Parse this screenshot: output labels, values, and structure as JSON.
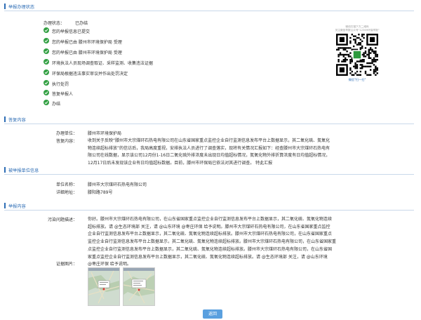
{
  "sections": {
    "status_title": "举报办理状态",
    "reply_title": "答复内容",
    "reported_title": "被举报单位信息",
    "content_title": "举报内容"
  },
  "status": {
    "label": "办理状态：",
    "value": "已办结",
    "steps": [
      "您的举报信息已提交",
      "您的举报已由 滕州市环境保护局 受理",
      "您的举报已由 滕州市环境保护局 受理",
      "环境执法人员现场调查取证、采样监测、收集违法证据",
      "环保局根据违法事实审议并作出处罚决定",
      "执行处罚",
      "答复举报人",
      "办结"
    ]
  },
  "qr": {
    "note_line1": "微信扫描下方二维码",
    "note_line2": "关注微信举报公众号\"12369环保举报\"",
    "scan_label": "微信\"扫一扫\""
  },
  "reply": {
    "unit_label": "办理单位：",
    "unit_value": "滕州市环境保护局",
    "content_label": "答复内容：",
    "content_lines": [
      "收到关于反映“滕州市大宗煤矸石热电有限公司在山东省国家重点监控企业自行监测信息发布平台上数据显示，其二氧化硫、氮氧化",
      "物连续超标排放”的信访后，我局高度重视，安排执法人员进行了调查落实，现将有关情况汇报如下：经查滕州市大宗煤矸石热电有",
      "限公司在线数据，显示该公司12月份1-16日二氧化硫外排浓度未出现日均值超标情况，氮氧化物外排折算浓度有日均值超标情况，",
      "12月17日后未发现该企业有日均值超标数据。目前，滕州市环保局已依法对其进行调查。 特此汇报"
    ]
  },
  "reported": {
    "name_label": "单位名称：",
    "name_value": "滕州市大宗煤矸石热电有限公司",
    "address_label": "详细地址：",
    "address_value": "滕阳路789号"
  },
  "complaint": {
    "desc_label": "污染问题描述：",
    "desc_lines": [
      "你好。滕州市大宗煤矸石热电有限公司，在山东省国家重点监控企业自行监测信息发布平台上数据显示，其二氧化硫、氮氧化物连续",
      "超标排放。请 @生态环境部 关注，请 @山东环境 @枣庄环保 给予说明。滕州市大宗煤矸石热电有限公司，在山东省国家重点监控",
      "企业自行监测信息发布平台上数据显示，其二氧化硫、氮氧化物连续超标排放。滕州市大宗煤矸石热电有限公司，在山东省国家重点",
      "监控企业自行监测信息发布平台上数据显示，其二氧化硫、氮氧化物连续超标排放。滕州市大宗煤矸石热电有限公司，在山东省国家重",
      "点监控企业自行监测信息发布平台上数据显示，其二氧化硫、氮氧化物连续超标排放。滕州市大宗煤矸石热电有限公司，在山东省国",
      "家重点监控企业自行监测信息发布平台上数据显示，其二氧化硫、氮氧化物连续超标排放。请 @生态环境部 关注，请 @山东环境",
      "@枣庄环保 给予说明。"
    ],
    "evidence_label": "证据图片："
  },
  "return_button": "返回",
  "colors": {
    "accent": "#2d6db5",
    "check": "#33a043",
    "button": "#5aa0df"
  }
}
